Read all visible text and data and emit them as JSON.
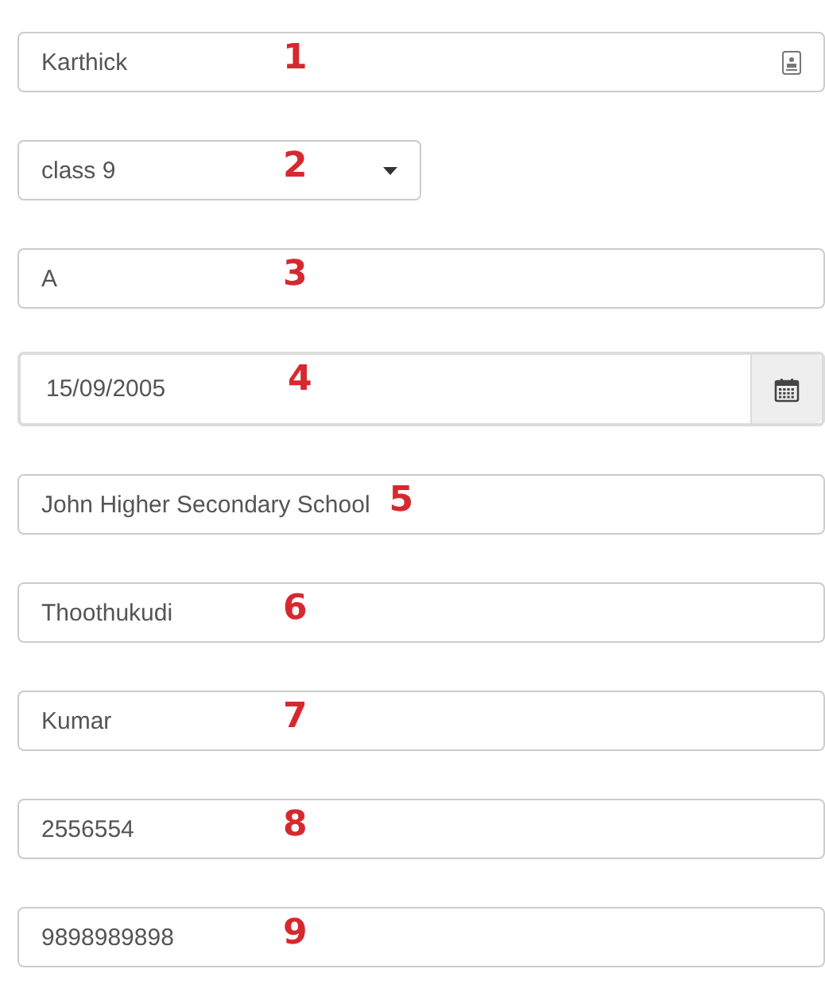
{
  "fields": [
    {
      "kind": "contact",
      "value": "Karthick",
      "marker": "1"
    },
    {
      "kind": "select",
      "value": "class 9",
      "marker": "2"
    },
    {
      "kind": "text",
      "value": "A",
      "marker": "3"
    },
    {
      "kind": "date",
      "value": "15/09/2005",
      "marker": "4"
    },
    {
      "kind": "text",
      "value": "John Higher Secondary School",
      "marker": "5"
    },
    {
      "kind": "text",
      "value": "Thoothukudi",
      "marker": "6"
    },
    {
      "kind": "text",
      "value": "Kumar",
      "marker": "7"
    },
    {
      "kind": "text",
      "value": "2556554",
      "marker": "8"
    },
    {
      "kind": "text",
      "value": "9898989898",
      "marker": "9"
    }
  ]
}
